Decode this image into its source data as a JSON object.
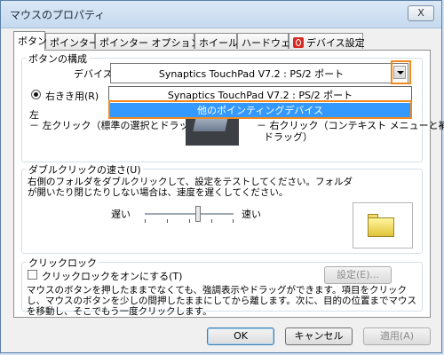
{
  "window": {
    "title": "マウスのプロパティ",
    "close_label": "X"
  },
  "tabs": [
    {
      "label": "ボタン",
      "active": true
    },
    {
      "label": "ポインター"
    },
    {
      "label": "ポインター オプション"
    },
    {
      "label": "ホイール"
    },
    {
      "label": "ハードウェア"
    },
    {
      "label": "デバイス設定",
      "icon": "synaptics-icon"
    }
  ],
  "button_config": {
    "group_title": "ボタンの構成",
    "device_label": "デバイス(V):",
    "device_selected": "Synaptics TouchPad V7.2 : PS/2 ポート",
    "dropdown_options": [
      "Synaptics TouchPad V7.2 : PS/2 ポート",
      "他のポインティングデバイス"
    ],
    "dropdown_selected_index": 1,
    "right_handed_label": "右きき用(R)",
    "left_label": "左",
    "left_click_text": "－ 左クリック（標準の選択とドラッグ）",
    "right_click_text": "－ 右クリック（コンテキスト メニューと補助",
    "right_click_text2": "ドラッグ）"
  },
  "double_click": {
    "group_title": "ダブルクリックの速さ(U)",
    "description": "右側のフォルダをダブルクリックして、設定をテストしてください。フォルダが開いたり閉じたりしない場合は、速度を遅くしてください。",
    "slow_label": "遅い",
    "fast_label": "速い",
    "speed_level": 0.6
  },
  "click_lock": {
    "group_title": "クリックロック",
    "checkbox_label": "クリックロックをオンにする(T)",
    "checked": false,
    "settings_button": "設定(E)...",
    "description": "マウスのボタンを押したままでなくても、強調表示やドラッグができます。項目をクリックし、マウスのボタンを少しの間押したままにしてから離します。次に、目的の位置までマウスを移動し、そこでもう一度クリックします。"
  },
  "footer": {
    "ok": "OK",
    "cancel": "キャンセル",
    "apply": "適用(A)"
  },
  "colors": {
    "highlight_outline": "#f08a1f",
    "selection": "#3399ff"
  }
}
